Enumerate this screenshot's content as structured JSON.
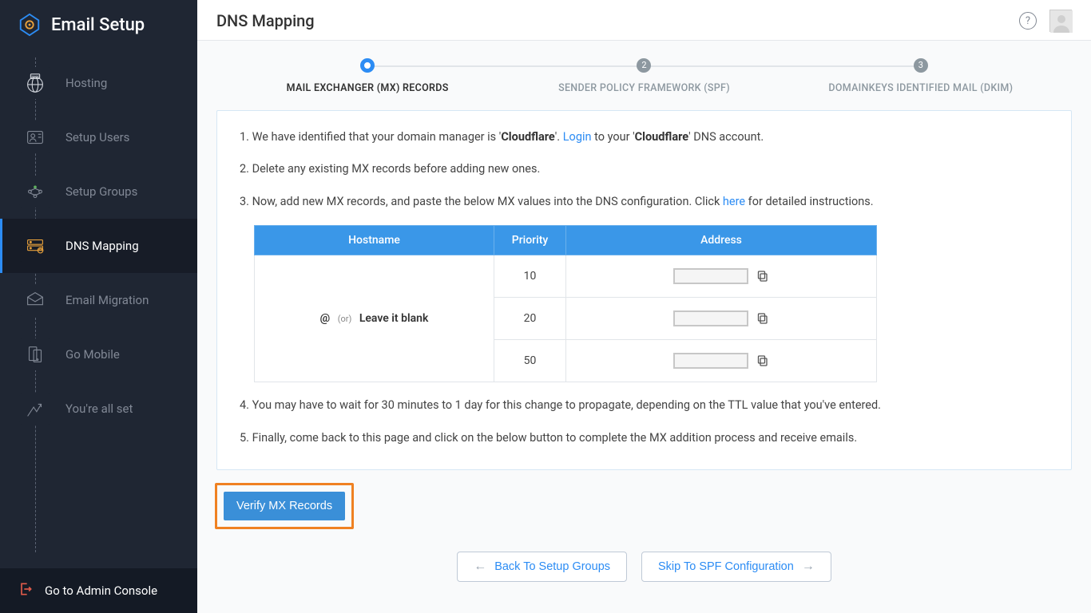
{
  "app_title": "Email Setup",
  "sidebar": {
    "items": [
      {
        "label": "Hosting",
        "active": false
      },
      {
        "label": "Setup Users",
        "active": false
      },
      {
        "label": "Setup Groups",
        "active": false
      },
      {
        "label": "DNS Mapping",
        "active": true
      },
      {
        "label": "Email Migration",
        "active": false
      },
      {
        "label": "Go Mobile",
        "active": false
      },
      {
        "label": "You're all set",
        "active": false
      }
    ],
    "footer": "Go to Admin Console"
  },
  "page_title": "DNS Mapping",
  "stepper": {
    "steps": [
      {
        "num": "",
        "label": "MAIL EXCHANGER (MX) RECORDS",
        "active": true
      },
      {
        "num": "2",
        "label": "SENDER POLICY FRAMEWORK (SPF)",
        "active": false
      },
      {
        "num": "3",
        "label": "DOMAINKEYS IDENTIFIED MAIL (DKIM)",
        "active": false
      }
    ]
  },
  "instructions": {
    "line1_pre": "1. We have identified that your domain manager is '",
    "line1_domain": "Cloudflare",
    "line1_mid": "'. ",
    "line1_login": "Login",
    "line1_post1": " to your '",
    "line1_post2": "' DNS account.",
    "line2": "2. Delete any existing MX records before adding new ones.",
    "line3_pre": "3. Now, add new MX records, and paste the below MX values into the DNS configuration. Click ",
    "line3_here": "here",
    "line3_post": " for detailed instructions.",
    "line4": "4. You may have to wait for 30 minutes to 1 day for this change to propagate, depending on the TTL value that you've entered.",
    "line5": "5. Finally, come back to this page and click on the below button to complete the MX addition process and receive emails."
  },
  "table": {
    "headers": {
      "host": "Hostname",
      "priority": "Priority",
      "address": "Address"
    },
    "host_at": "@",
    "host_or": "(or)",
    "host_blank": "Leave it blank",
    "rows": [
      {
        "priority": "10"
      },
      {
        "priority": "20"
      },
      {
        "priority": "50"
      }
    ]
  },
  "buttons": {
    "verify": "Verify MX Records",
    "back": "Back To Setup Groups",
    "skip": "Skip To SPF Configuration"
  }
}
